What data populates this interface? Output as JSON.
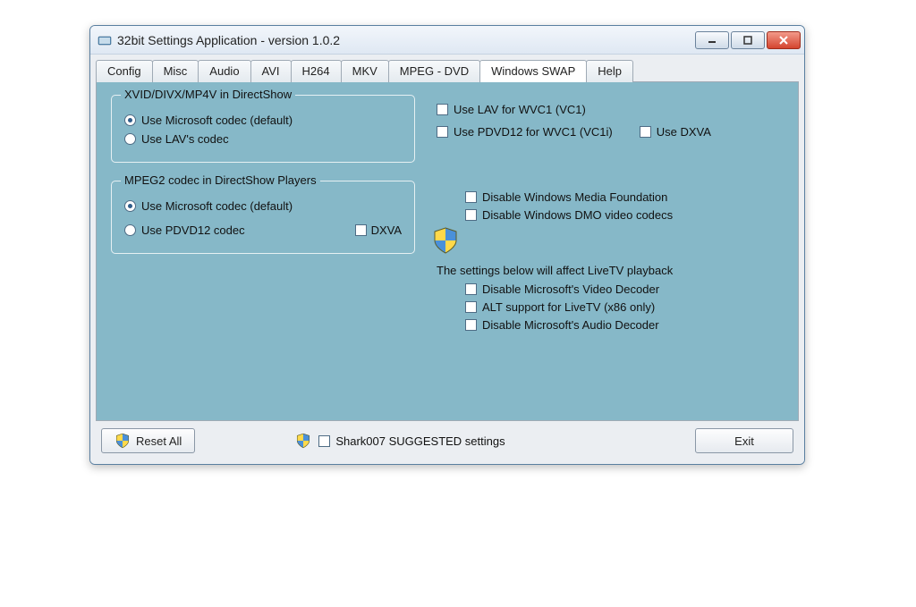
{
  "window": {
    "title": "32bit Settings Application - version 1.0.2"
  },
  "tabs": [
    "Config",
    "Misc",
    "Audio",
    "AVI",
    "H264",
    "MKV",
    "MPEG - DVD",
    "Windows SWAP",
    "Help"
  ],
  "activeTab": "Windows SWAP",
  "group1": {
    "legend": "XVID/DIVX/MP4V in DirectShow",
    "opt1": "Use Microsoft codec (default)",
    "opt2": "Use LAV's codec"
  },
  "group2": {
    "legend": "MPEG2 codec in DirectShow Players",
    "opt1": "Use Microsoft codec (default)",
    "opt2": "Use PDVD12 codec",
    "dxva": "DXVA"
  },
  "right": {
    "lav_wvc1": "Use LAV for WVC1 (VC1)",
    "pdvd12_wvc1i": "Use PDVD12 for WVC1 (VC1i)",
    "use_dxva": "Use DXVA",
    "disable_mf": "Disable Windows Media Foundation",
    "disable_dmo": "Disable Windows DMO video codecs",
    "info": "The settings below will affect LiveTV playback",
    "disable_video_decoder": "Disable Microsoft's Video Decoder",
    "alt_livetv": "ALT support for LiveTV (x86 only)",
    "disable_audio_decoder": "Disable Microsoft's Audio Decoder"
  },
  "footer": {
    "reset": "Reset All",
    "suggested": "Shark007 SUGGESTED settings",
    "exit": "Exit"
  }
}
